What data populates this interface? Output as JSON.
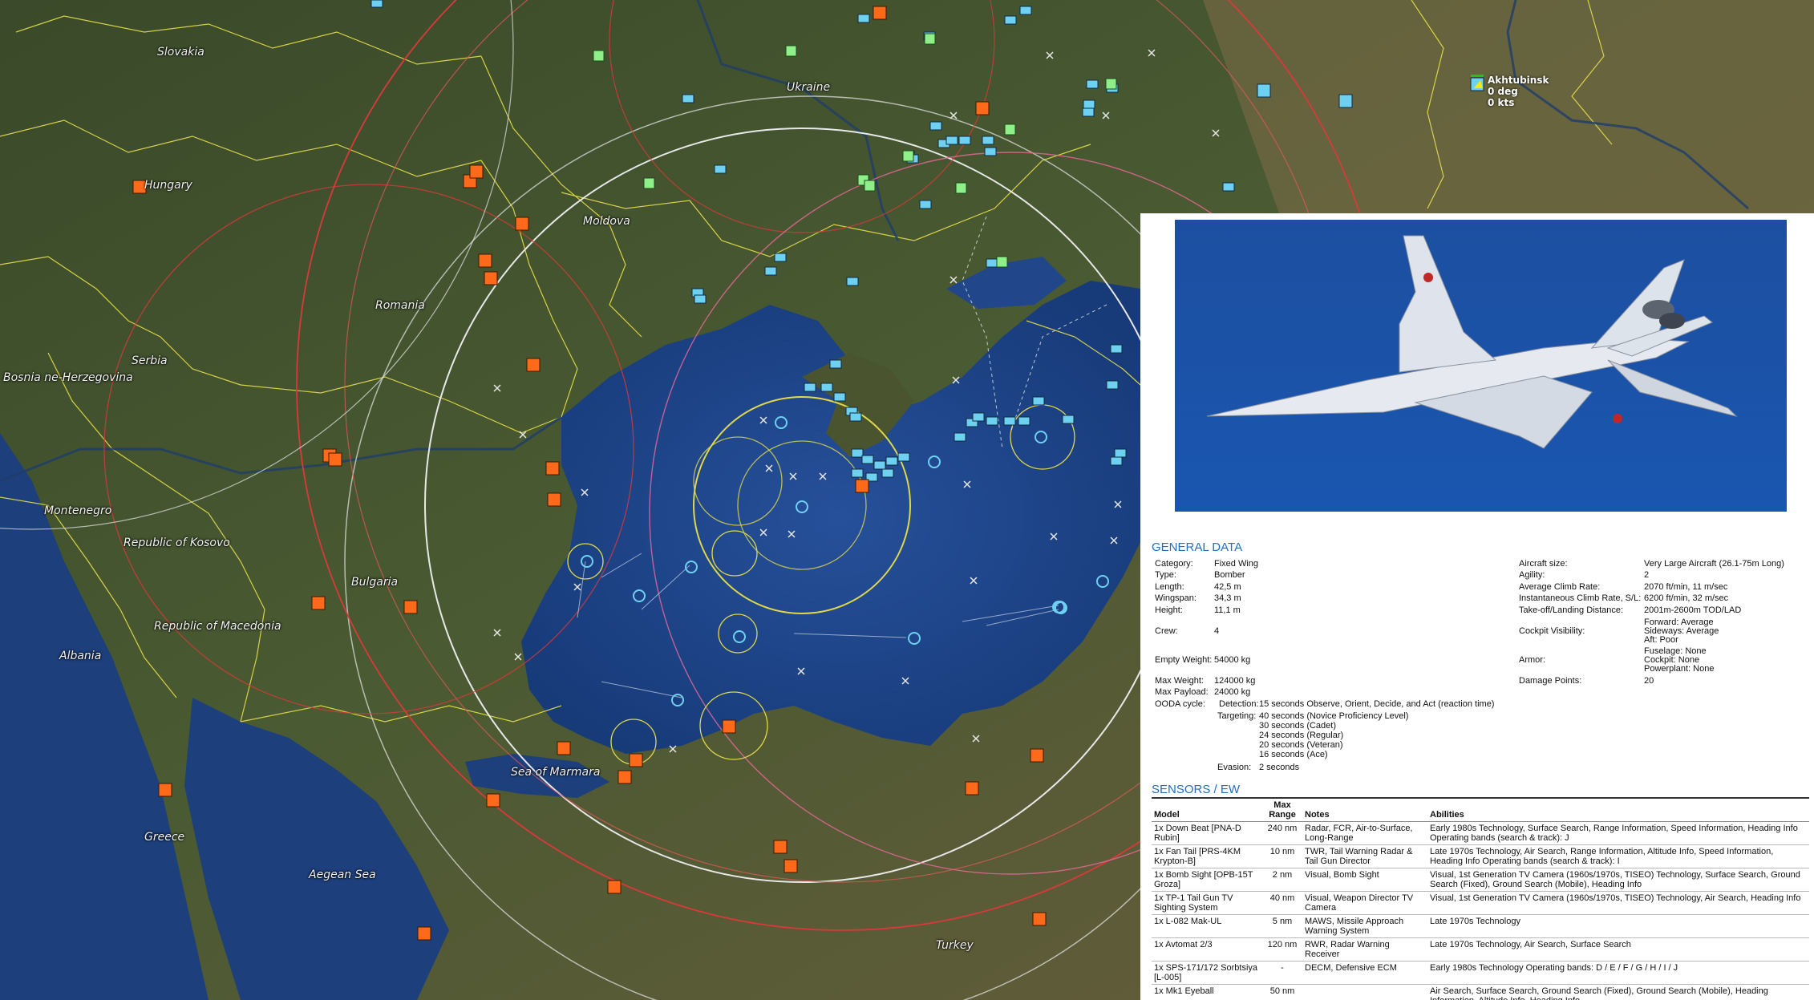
{
  "map": {
    "labels": {
      "slovakia": "Slovakia",
      "ukraine": "Ukraine",
      "hungary": "Hungary",
      "moldova": "Moldova",
      "romania": "Romania",
      "serbia": "Serbia",
      "bosnia": "Bosnia ne-Herzegovina",
      "montenegro": "Montenegro",
      "kosovo": "Republic of Kosovo",
      "bulgaria": "Bulgaria",
      "macedonia": "Republic of Macedonia",
      "albania": "Albania",
      "greece": "Greece",
      "aegean": "Aegean Sea",
      "marmara": "Sea of Marmara",
      "turkey": "Turkey"
    },
    "unit_readout": {
      "name": "Akhtubinsk",
      "heading": "0 deg",
      "speed": "0 kts"
    },
    "colors": {
      "sea": "#1e3f7a",
      "land": "#3f4f2c",
      "border": "#e6e04a",
      "range_red": "#d83a3a",
      "range_white": "#e8e8e8",
      "range_yellow": "#e0d84a",
      "friendly": "#6fd1f2",
      "hostile": "#ff6a1a",
      "neutral": "#8ff08a"
    }
  },
  "panel": {
    "general_title": "GENERAL DATA",
    "left": [
      {
        "label": "Category:",
        "value": "Fixed Wing"
      },
      {
        "label": "Type:",
        "value": "Bomber"
      },
      {
        "label": "Length:",
        "value": "42,5 m"
      },
      {
        "label": "Wingspan:",
        "value": "34,3 m"
      },
      {
        "label": "Height:",
        "value": "11,1 m"
      },
      {
        "label": "Crew:",
        "value": "4"
      },
      {
        "label": "Empty Weight:",
        "value": "54000 kg"
      },
      {
        "label": "Max Weight:",
        "value": "124000 kg"
      },
      {
        "label": "Max Payload:",
        "value": "24000 kg"
      }
    ],
    "right": [
      {
        "label": "Aircraft size:",
        "value": "Very Large Aircraft (26.1-75m Long)"
      },
      {
        "label": "Agility:",
        "value": "2"
      },
      {
        "label": "Average Climb Rate:",
        "value": "2070 ft/min, 11 m/sec"
      },
      {
        "label": "Instantaneous Climb Rate, S/L:",
        "value": "6200 ft/min, 32 m/sec"
      },
      {
        "label": "Take-off/Landing Distance:",
        "value": "2001m-2600m TOD/LAD"
      },
      {
        "label": "Cockpit Visibility:",
        "lines": [
          "Forward: Average",
          "Sideways: Average",
          "Aft: Poor"
        ]
      },
      {
        "label": "Armor:",
        "lines": [
          "Fuselage: None",
          "Cockpit: None",
          "Powerplant: None"
        ]
      },
      {
        "label": "Damage Points:",
        "value": "20"
      }
    ],
    "ooda": {
      "label": "OODA cycle:",
      "detection_label": "Detection:",
      "detection": "15 seconds Observe, Orient, Decide, and Act (reaction time)",
      "targeting_label": "Targeting:",
      "targeting": [
        "40 seconds (Novice Proficiency Level)",
        "30 seconds (Cadet)",
        "24 seconds (Regular)",
        "20 seconds (Veteran)",
        "16 seconds (Ace)"
      ],
      "evasion_label": "Evasion:",
      "evasion": "2 seconds"
    },
    "sensors_title": "SENSORS / EW",
    "table_headers": {
      "model": "Model",
      "range": "Max Range",
      "notes": "Notes",
      "abilities": "Abilities"
    },
    "sensors": [
      {
        "model": "1x Down Beat [PNA-D Rubin]",
        "range": "240 nm",
        "notes": "Radar, FCR, Air-to-Surface, Long-Range",
        "abilities": "Early 1980s Technology, Surface Search, Range Information, Speed Information, Heading Info Operating bands (search & track): J"
      },
      {
        "model": "1x Fan Tail [PRS-4KM Krypton-B]",
        "range": "10 nm",
        "notes": "TWR, Tail Warning Radar & Tail Gun Director",
        "abilities": "Late 1970s Technology, Air Search, Range Information, Altitude Info, Speed Information, Heading Info Operating bands (search & track): I"
      },
      {
        "model": "1x Bomb Sight [OPB-15T Groza]",
        "range": "2 nm",
        "notes": "Visual, Bomb Sight",
        "abilities": "Visual, 1st Generation TV Camera (1960s/1970s, TISEO) Technology, Surface Search, Ground Search (Fixed), Ground Search (Mobile), Heading Info"
      },
      {
        "model": "1x TP-1 Tail Gun TV Sighting System",
        "range": "40 nm",
        "notes": "Visual, Weapon Director TV Camera",
        "abilities": "Visual, 1st Generation TV Camera (1960s/1970s, TISEO) Technology, Air Search, Heading Info"
      },
      {
        "model": "1x L-082 Mak-UL",
        "range": "5 nm",
        "notes": "MAWS, Missile Approach Warning System",
        "abilities": "Late 1970s Technology"
      },
      {
        "model": "1x Avtomat 2/3",
        "range": "120 nm",
        "notes": "RWR, Radar Warning Receiver",
        "abilities": "Late 1970s Technology, Air Search, Surface Search"
      },
      {
        "model": "1x SPS-171/172 Sorbtsiya [L-005]",
        "range": "-",
        "notes": "DECM, Defensive ECM",
        "abilities": "Early 1980s Technology Operating bands: D / E / F / G / H / I / J"
      },
      {
        "model": "1x Mk1 Eyeball",
        "range": "50 nm",
        "notes": "",
        "abilities": "Air Search, Surface Search, Ground Search (Fixed), Ground Search (Mobile), Heading Information, Altitude Info, Heading Info"
      }
    ]
  }
}
